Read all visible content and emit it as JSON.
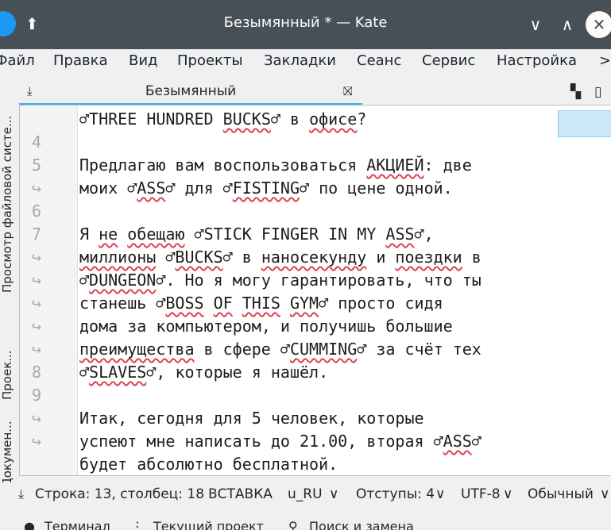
{
  "window": {
    "title": "Безымянный * — Kate",
    "pin_glyph": "⬆",
    "minimize_glyph": "∨",
    "maximize_glyph": "∧",
    "close_glyph": "✕"
  },
  "menu": [
    "Файл",
    "Правка",
    "Вид",
    "Проекты",
    "Закладки",
    "Сеанс",
    "Сервис",
    "Настройка",
    ">"
  ],
  "tab": {
    "label": "Безымянный",
    "left_glyph": "⤓",
    "close_glyph": "⛝"
  },
  "side_panel": {
    "items": [
      "Просмотр файловой систе...",
      "Проек...",
      "Докумен..."
    ]
  },
  "editor": {
    "wrap_glyph": "↪",
    "gutter": [
      "↪",
      "4",
      "5",
      "↪",
      "6",
      "7",
      "↪",
      "↪",
      "↪",
      "↪",
      "↪",
      "8",
      "9",
      "↪",
      "↪"
    ],
    "lines": [
      "♂THREE HUNDRED BUCKS♂ в офисе?",
      "",
      "Предлагаю вам воспользоваться АКЦИЕЙ: две",
      "моих ♂ASS♂ для ♂FISTING♂ по цене одной.",
      "",
      "Я не обещаю ♂STICK FINGER IN MY ASS♂,",
      "миллионы ♂BUCKS♂ в наносекунду и поездки в",
      "♂DUNGEON♂. Но я могу гарантировать, что ты",
      "станешь ♂BOSS OF THIS GYM♂ просто сидя",
      "дома за компьютером, и получишь большие",
      "преимущества в сфере ♂CUMMING♂ за счёт тех",
      "♂SLAVES♂, которые я нашёл.",
      "",
      "Итак, сегодня для 5 человек, которые",
      "успеют мне написать до 21.00, вторая ♂ASS♂",
      "будет абсолютно бесплатной."
    ]
  },
  "status": {
    "position": "Строка: 13, столбец: 18",
    "mode": "ВСТАВКА",
    "dictionary": "u_RU",
    "indent": "Отступы: 4",
    "encoding": "UTF-8",
    "highlight": "Обычный",
    "chevron": "∨"
  },
  "toolviews": [
    "Терминал",
    "Текущий проект",
    "Поиск и замена"
  ]
}
